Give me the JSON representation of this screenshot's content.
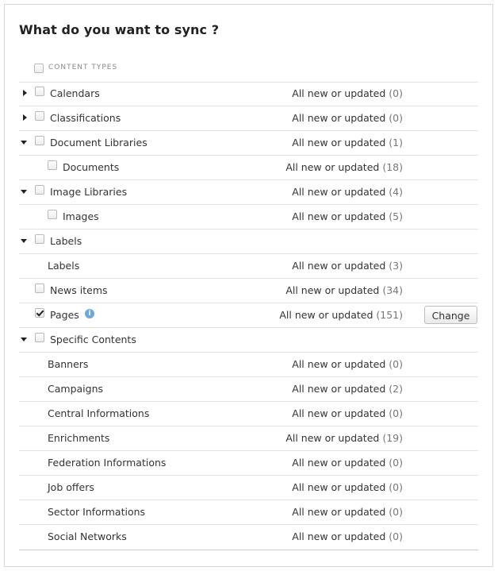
{
  "title": "What do you want to sync ?",
  "header": {
    "label": "CONTENT TYPES",
    "checked": false
  },
  "rows": [
    {
      "name": "calendars",
      "label": "Calendars",
      "status": "All new or updated",
      "count": "(0)",
      "toggle": "collapsed",
      "checkbox": true,
      "checked": false,
      "level": 0
    },
    {
      "name": "classifications",
      "label": "Classifications",
      "status": "All new or updated",
      "count": "(0)",
      "toggle": "collapsed",
      "checkbox": true,
      "checked": false,
      "level": 0
    },
    {
      "name": "document-libraries",
      "label": "Document Libraries",
      "status": "All new or updated",
      "count": "(1)",
      "toggle": "expanded",
      "checkbox": true,
      "checked": false,
      "level": 0
    },
    {
      "name": "documents",
      "label": "Documents",
      "status": "All new or updated",
      "count": "(18)",
      "toggle": null,
      "checkbox": true,
      "checked": false,
      "level": 1
    },
    {
      "name": "image-libraries",
      "label": "Image Libraries",
      "status": "All new or updated",
      "count": "(4)",
      "toggle": "expanded",
      "checkbox": true,
      "checked": false,
      "level": 0
    },
    {
      "name": "images",
      "label": "Images",
      "status": "All new or updated",
      "count": "(5)",
      "toggle": null,
      "checkbox": true,
      "checked": false,
      "level": 1
    },
    {
      "name": "labels-group",
      "label": "Labels",
      "status": "",
      "count": "",
      "toggle": "expanded",
      "checkbox": true,
      "checked": false,
      "level": 0
    },
    {
      "name": "labels",
      "label": "Labels",
      "status": "All new or updated",
      "count": "(3)",
      "toggle": null,
      "checkbox": false,
      "checked": false,
      "level": 0
    },
    {
      "name": "news-items",
      "label": "News items",
      "status": "All new or updated",
      "count": "(34)",
      "toggle": null,
      "checkbox": true,
      "checked": false,
      "level": 0
    },
    {
      "name": "pages",
      "label": "Pages",
      "status": "All new or updated",
      "count": "(151)",
      "toggle": null,
      "checkbox": true,
      "checked": true,
      "level": 0,
      "info": true,
      "button": "Change"
    },
    {
      "name": "specific-contents",
      "label": "Specific Contents",
      "status": "",
      "count": "",
      "toggle": "expanded",
      "checkbox": true,
      "checked": false,
      "level": 0
    },
    {
      "name": "banners",
      "label": "Banners",
      "status": "All new or updated",
      "count": "(0)",
      "toggle": null,
      "checkbox": false,
      "checked": false,
      "level": 0
    },
    {
      "name": "campaigns",
      "label": "Campaigns",
      "status": "All new or updated",
      "count": "(2)",
      "toggle": null,
      "checkbox": false,
      "checked": false,
      "level": 0
    },
    {
      "name": "central-informations",
      "label": "Central Informations",
      "status": "All new or updated",
      "count": "(0)",
      "toggle": null,
      "checkbox": false,
      "checked": false,
      "level": 0
    },
    {
      "name": "enrichments",
      "label": "Enrichments",
      "status": "All new or updated",
      "count": "(19)",
      "toggle": null,
      "checkbox": false,
      "checked": false,
      "level": 0
    },
    {
      "name": "federation-informations",
      "label": "Federation Informations",
      "status": "All new or updated",
      "count": "(0)",
      "toggle": null,
      "checkbox": false,
      "checked": false,
      "level": 0
    },
    {
      "name": "job-offers",
      "label": "Job offers",
      "status": "All new or updated",
      "count": "(0)",
      "toggle": null,
      "checkbox": false,
      "checked": false,
      "level": 0
    },
    {
      "name": "sector-informations",
      "label": "Sector Informations",
      "status": "All new or updated",
      "count": "(0)",
      "toggle": null,
      "checkbox": false,
      "checked": false,
      "level": 0
    },
    {
      "name": "social-networks",
      "label": "Social Networks",
      "status": "All new or updated",
      "count": "(0)",
      "toggle": null,
      "checkbox": false,
      "checked": false,
      "level": 0
    }
  ]
}
